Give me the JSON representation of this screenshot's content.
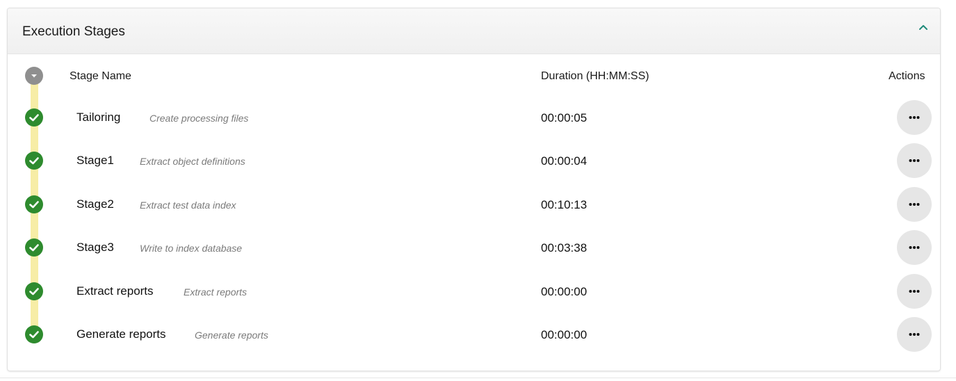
{
  "panel": {
    "title": "Execution Stages",
    "collapse_icon": "chevron-up-icon",
    "accent_color": "#1f8a7a"
  },
  "columns": {
    "stage_name": "Stage Name",
    "duration": "Duration (HH:MM:SS)",
    "actions": "Actions"
  },
  "colors": {
    "success": "#2e8b2e",
    "timeline": "#f7eda6",
    "toggle": "#8f8f8f",
    "action_button": "#e6e6e6"
  },
  "stages": [
    {
      "name": "Tailoring",
      "description": "Create processing files",
      "duration": "00:00:05",
      "status": "completed",
      "status_icon": "check-circle-icon",
      "action_icon": "more-horizontal-icon"
    },
    {
      "name": "Stage1",
      "description": "Extract object definitions",
      "duration": "00:00:04",
      "status": "completed",
      "status_icon": "check-circle-icon",
      "action_icon": "more-horizontal-icon"
    },
    {
      "name": "Stage2",
      "description": "Extract test data index",
      "duration": "00:10:13",
      "status": "completed",
      "status_icon": "check-circle-icon",
      "action_icon": "more-horizontal-icon"
    },
    {
      "name": "Stage3",
      "description": "Write to index database",
      "duration": "00:03:38",
      "status": "completed",
      "status_icon": "check-circle-icon",
      "action_icon": "more-horizontal-icon"
    },
    {
      "name": "Extract reports",
      "description": "Extract reports",
      "duration": "00:00:00",
      "status": "completed",
      "status_icon": "check-circle-icon",
      "action_icon": "more-horizontal-icon"
    },
    {
      "name": "Generate reports",
      "description": "Generate reports",
      "duration": "00:00:00",
      "status": "completed",
      "status_icon": "check-circle-icon",
      "action_icon": "more-horizontal-icon"
    }
  ]
}
